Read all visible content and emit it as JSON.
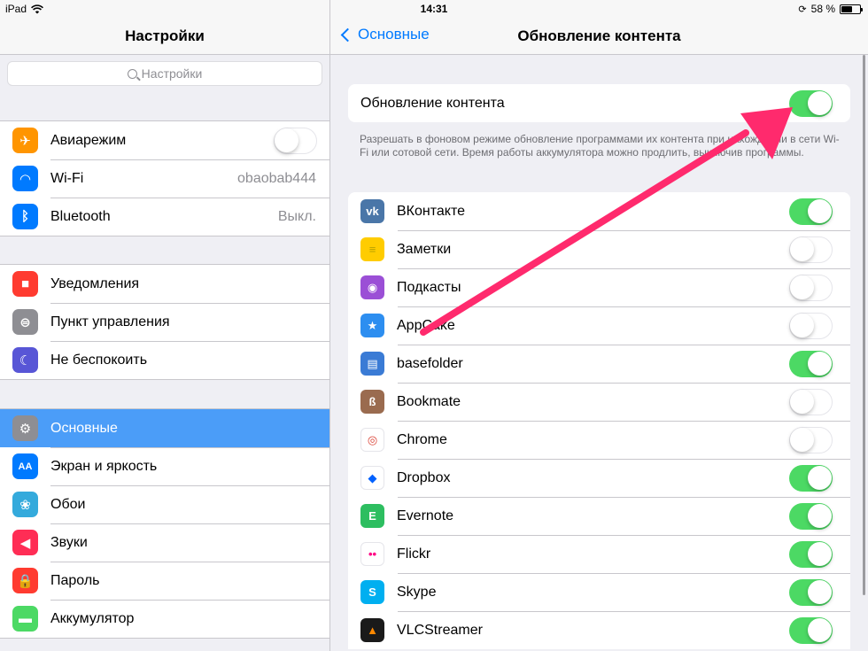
{
  "status": {
    "device": "iPad",
    "time": "14:31",
    "battery_pct": "58 %",
    "battery_level": 0.58
  },
  "left": {
    "title": "Настройки",
    "search_placeholder": "Настройки",
    "groups": [
      [
        {
          "label": "Авиарежим",
          "icon": "airplane-icon",
          "color": "#ff9500",
          "toggle": "off"
        },
        {
          "label": "Wi-Fi",
          "icon": "wifi-icon",
          "color": "#007aff",
          "value": "obaobab444"
        },
        {
          "label": "Bluetooth",
          "icon": "bluetooth-icon",
          "color": "#007aff",
          "value": "Выкл."
        }
      ],
      [
        {
          "label": "Уведомления",
          "icon": "notifications-icon",
          "color": "#ff3b30"
        },
        {
          "label": "Пункт управления",
          "icon": "control-center-icon",
          "color": "#8e8e93"
        },
        {
          "label": "Не беспокоить",
          "icon": "moon-icon",
          "color": "#5856d6"
        }
      ],
      [
        {
          "label": "Основные",
          "icon": "gear-icon",
          "color": "#8e8e93",
          "selected": true
        },
        {
          "label": "Экран и яркость",
          "icon": "display-icon",
          "color": "#007aff"
        },
        {
          "label": "Обои",
          "icon": "wallpaper-icon",
          "color": "#34aadc"
        },
        {
          "label": "Звуки",
          "icon": "sound-icon",
          "color": "#ff2d55"
        },
        {
          "label": "Пароль",
          "icon": "lock-icon",
          "color": "#ff3b30"
        },
        {
          "label": "Аккумулятор",
          "icon": "battery-icon",
          "color": "#4cd964"
        }
      ]
    ]
  },
  "right": {
    "back_label": "Основные",
    "title": "Обновление контента",
    "master": {
      "label": "Обновление контента",
      "toggle": "on"
    },
    "footnote": "Разрешать в фоновом режиме обновление программами их контента при нахождении в сети Wi-Fi или сотовой сети. Время работы аккумулятора можно продлить, выключив программы.",
    "apps": [
      {
        "label": "ВКонтакте",
        "icon": "vk-icon",
        "color": "#4a76a8",
        "toggle": "on"
      },
      {
        "label": "Заметки",
        "icon": "notes-icon",
        "color": "#ffcc00",
        "toggle": "off"
      },
      {
        "label": "Подкасты",
        "icon": "podcasts-icon",
        "color": "#9b4fd6",
        "toggle": "off"
      },
      {
        "label": "AppCake",
        "icon": "appcake-icon",
        "color": "#2d8ef0",
        "toggle": "off"
      },
      {
        "label": "basefolder",
        "icon": "basefolder-icon",
        "color": "#3a7bd5",
        "toggle": "on"
      },
      {
        "label": "Bookmate",
        "icon": "bookmate-icon",
        "color": "#9a6b4f",
        "toggle": "off"
      },
      {
        "label": "Chrome",
        "icon": "chrome-icon",
        "color": "#ffffff",
        "toggle": "off"
      },
      {
        "label": "Dropbox",
        "icon": "dropbox-icon",
        "color": "#ffffff",
        "toggle": "on"
      },
      {
        "label": "Evernote",
        "icon": "evernote-icon",
        "color": "#2dbe60",
        "toggle": "on"
      },
      {
        "label": "Flickr",
        "icon": "flickr-icon",
        "color": "#ffffff",
        "toggle": "on"
      },
      {
        "label": "Skype",
        "icon": "skype-icon",
        "color": "#00aff0",
        "toggle": "on"
      },
      {
        "label": "VLCStreamer",
        "icon": "vlc-icon",
        "color": "#1a1a1a",
        "toggle": "on"
      }
    ]
  },
  "colors": {
    "accent": "#007aff",
    "toggle_on": "#4cd964",
    "selected_row": "#4b9df8",
    "annotation_arrow": "#ff2a6d"
  }
}
